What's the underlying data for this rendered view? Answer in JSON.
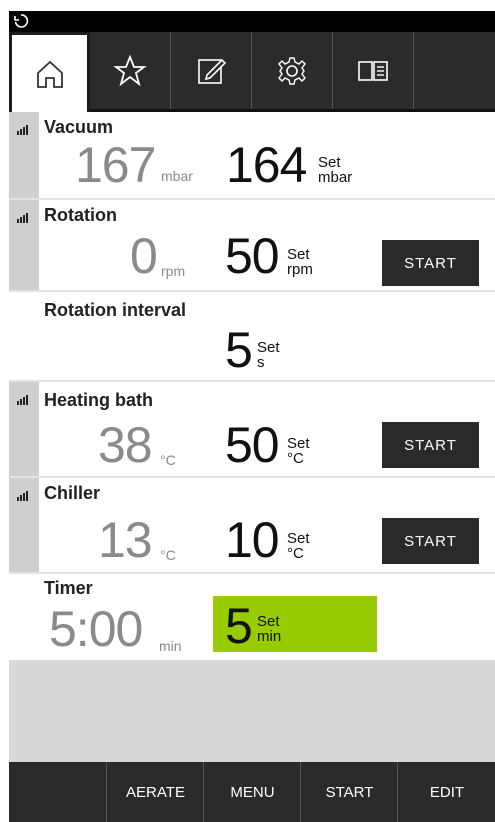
{
  "tabs": [
    {
      "name": "home-icon",
      "active": true
    },
    {
      "name": "star-icon",
      "active": false
    },
    {
      "name": "edit-icon",
      "active": false
    },
    {
      "name": "gear-icon",
      "active": false
    },
    {
      "name": "book-icon",
      "active": false
    }
  ],
  "vacuum": {
    "title": "Vacuum",
    "actual": "167",
    "actual_unit": "mbar",
    "set": "164",
    "set_label": "Set",
    "set_unit": "mbar"
  },
  "rotation": {
    "title": "Rotation",
    "actual": "0",
    "actual_unit": "rpm",
    "set": "50",
    "set_label": "Set",
    "set_unit": "rpm",
    "button": "START"
  },
  "rotation_interval": {
    "title": "Rotation interval",
    "set": "5",
    "set_label": "Set",
    "set_unit": "s"
  },
  "heating_bath": {
    "title": "Heating bath",
    "actual": "38",
    "actual_unit": "°C",
    "set": "50",
    "set_label": "Set",
    "set_unit": "°C",
    "button": "START"
  },
  "chiller": {
    "title": "Chiller",
    "actual": "13",
    "actual_unit": "°C",
    "set": "10",
    "set_label": "Set",
    "set_unit": "°C",
    "button": "START"
  },
  "timer": {
    "title": "Timer",
    "actual": "5:00",
    "actual_unit": "min",
    "set": "5",
    "set_label": "Set",
    "set_unit": "min"
  },
  "bottom_bar": {
    "aerate": "AERATE",
    "menu": "MENU",
    "start": "START",
    "edit": "EDIT"
  },
  "colors": {
    "accent_green": "#99cc00",
    "dark_button": "#2a2a2a",
    "sensor_strip": "#cfcfcf"
  }
}
